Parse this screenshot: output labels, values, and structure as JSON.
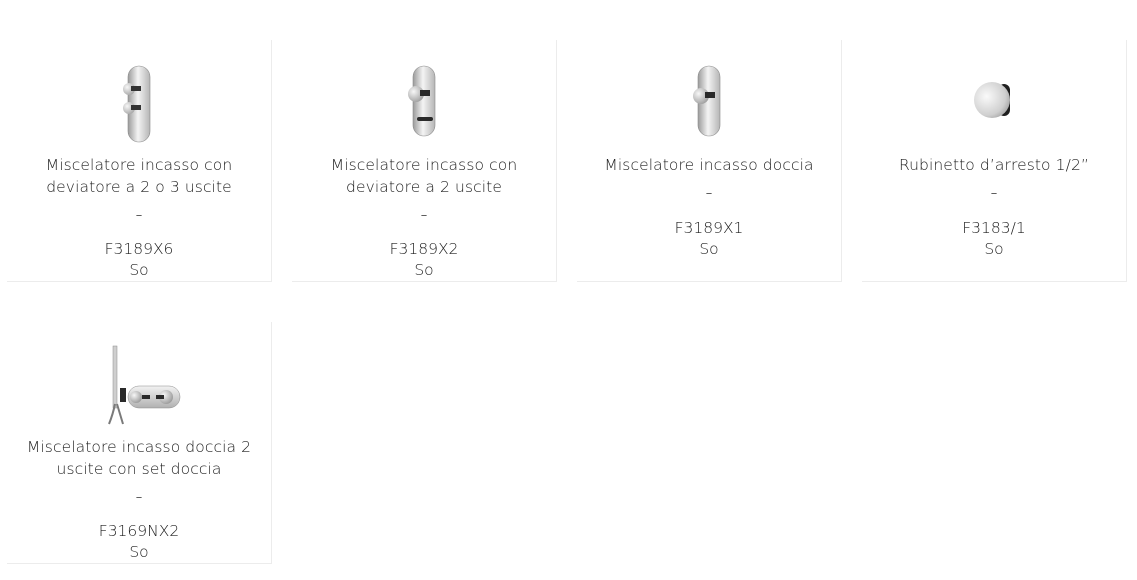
{
  "products": [
    {
      "title": "Miscelatore incasso con deviatore a 2 o 3 uscite",
      "separator": "–",
      "code": "F3189X6",
      "finish": "So",
      "icon": "shower-mixer-two-knobs-icon"
    },
    {
      "title": "Miscelatore incasso con deviatore a 2 uscite",
      "separator": "–",
      "code": "F3189X2",
      "finish": "So",
      "icon": "shower-mixer-diverter-icon"
    },
    {
      "title": "Miscelatore incasso doccia",
      "separator": "–",
      "code": "F3189X1",
      "finish": "So",
      "icon": "shower-mixer-single-icon"
    },
    {
      "title": "Rubinetto d’arresto 1/2”",
      "separator": "–",
      "code": "F3183/1",
      "finish": "So",
      "icon": "stop-valve-knob-icon"
    },
    {
      "title": "Miscelatore incasso doccia 2 uscite con set doccia",
      "separator": "–",
      "code": "F3169NX2",
      "finish": "So",
      "icon": "shower-set-mixer-icon"
    }
  ]
}
